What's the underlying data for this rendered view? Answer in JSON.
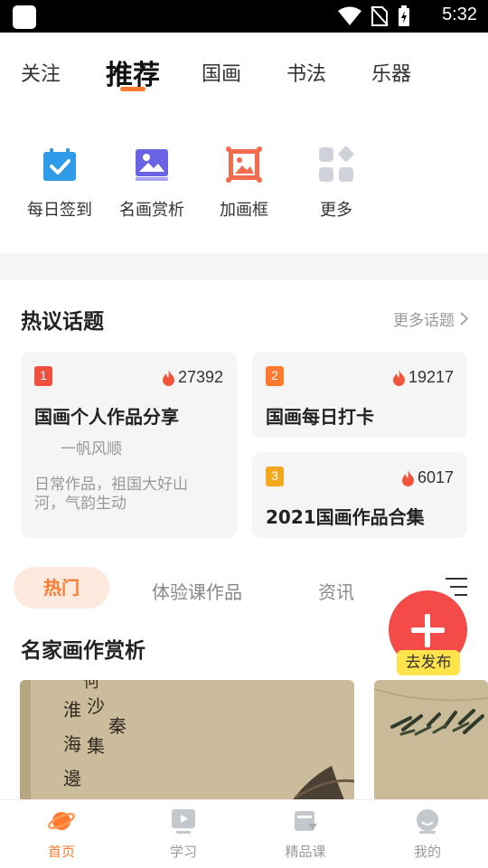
{
  "status_bar": {
    "time": "5:32"
  },
  "top_tabs": [
    {
      "label": "关注"
    },
    {
      "label": "推荐",
      "active": true
    },
    {
      "label": "国画"
    },
    {
      "label": "书法"
    },
    {
      "label": "乐器"
    }
  ],
  "quick_actions": [
    {
      "label": "每日签到",
      "icon": "calendar-check-icon"
    },
    {
      "label": "名画赏析",
      "icon": "picture-icon"
    },
    {
      "label": "加画框",
      "icon": "frame-icon"
    },
    {
      "label": "更多",
      "icon": "grid-more-icon"
    }
  ],
  "topics": {
    "title": "热议话题",
    "more_label": "更多话题",
    "cards": [
      {
        "rank": "1",
        "heat": "27392",
        "title": "国画个人作品分享",
        "author": "一帆风顺",
        "desc": "日常作品，祖国大好山河，气韵生动",
        "badge_color": "#f04e3e"
      },
      {
        "rank": "2",
        "heat": "19217",
        "title": "国画每日打卡",
        "badge_color": "#ff7a2e"
      },
      {
        "rank": "3",
        "heat": "6017",
        "title": "2021国画作品合集",
        "badge_color": "#f6a81d"
      }
    ]
  },
  "categories": [
    {
      "label": "热门",
      "active": true
    },
    {
      "label": "体验课作品"
    },
    {
      "label": "资讯"
    }
  ],
  "publish_button": {
    "label": "去发布"
  },
  "masters": {
    "title": "名家画作赏析"
  },
  "bottom_nav": [
    {
      "label": "首页",
      "icon": "planet-home-icon",
      "active": true
    },
    {
      "label": "学习",
      "icon": "video-play-icon"
    },
    {
      "label": "精品课",
      "icon": "course-book-icon"
    },
    {
      "label": "我的",
      "icon": "profile-face-icon"
    }
  ],
  "colors": {
    "accent": "#ff7a2e",
    "fab": "#f54b48",
    "fab_label_bg": "#ffe34a",
    "card_bg": "#f5f5f5"
  }
}
